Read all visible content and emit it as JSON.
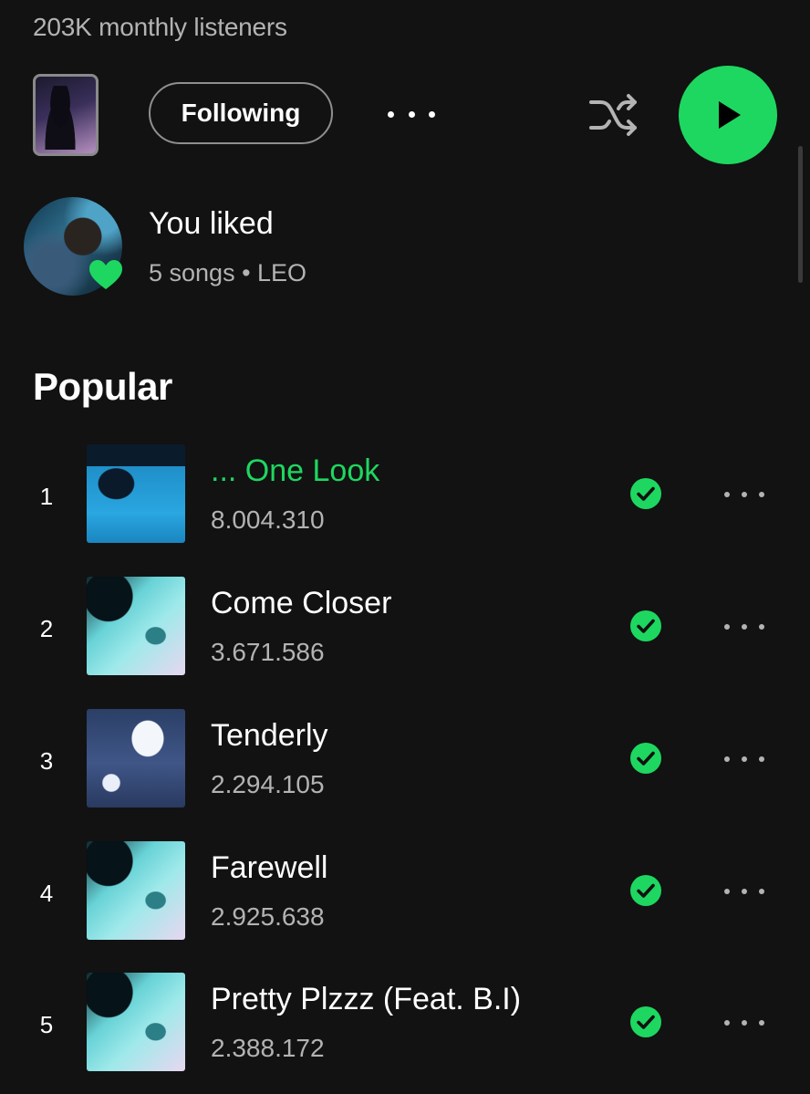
{
  "header": {
    "monthly_listeners": "203K monthly listeners",
    "following_label": "Following"
  },
  "icons": {
    "more": "more-horizontal-icon",
    "shuffle": "shuffle-icon",
    "play": "play-icon",
    "heart": "heart-icon",
    "downloaded": "check-circle-icon"
  },
  "colors": {
    "accent": "#1ed760",
    "background": "#121212",
    "muted_text": "#b3b3b3"
  },
  "liked": {
    "title": "You liked",
    "subtitle": "5 songs • LEO"
  },
  "popular": {
    "title": "Popular",
    "tracks": [
      {
        "rank": "1",
        "title": "... One Look",
        "plays": "8.004.310",
        "playing": true
      },
      {
        "rank": "2",
        "title": "Come Closer",
        "plays": "3.671.586",
        "playing": false
      },
      {
        "rank": "3",
        "title": "Tenderly",
        "plays": "2.294.105",
        "playing": false
      },
      {
        "rank": "4",
        "title": "Farewell",
        "plays": "2.925.638",
        "playing": false
      },
      {
        "rank": "5",
        "title": "Pretty Plzzz (Feat. B.I)",
        "plays": "2.388.172",
        "playing": false
      }
    ]
  }
}
